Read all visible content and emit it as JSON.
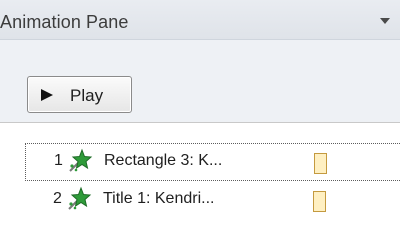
{
  "pane": {
    "title": "Animation Pane",
    "dropdown_icon": "triangle-down-icon"
  },
  "toolbar": {
    "play_label": "Play",
    "play_icon": "play-icon"
  },
  "animation_list": {
    "items": [
      {
        "number": "1",
        "label": "Rectangle 3: K...",
        "effect_icon": "entrance-star-icon"
      },
      {
        "number": "2",
        "label": "Title 1: Kendri...",
        "effect_icon": "entrance-star-icon"
      }
    ]
  },
  "colors": {
    "title_bar": "#e9ecf1",
    "toolbar_bg": "#eef1f5",
    "star_green": "#2f9b3a",
    "timing_bar_fill": "#fff0c2",
    "timing_bar_border": "#c49a3f"
  }
}
